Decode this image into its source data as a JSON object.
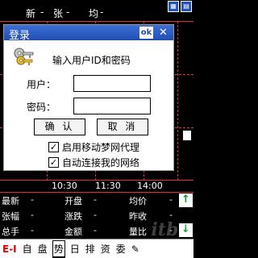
{
  "header": {
    "stats": [
      "新",
      "张",
      "均"
    ],
    "dash": "-",
    "icons": [
      "grid-icon",
      "panel-icon"
    ]
  },
  "time_axis": [
    "10:30",
    "11:30",
    "14:00"
  ],
  "quote": {
    "rows": [
      [
        {
          "label": "最新",
          "value": "-"
        },
        {
          "label": "开盘",
          "value": "-"
        },
        {
          "label": "均价",
          "value": "-"
        }
      ],
      [
        {
          "label": "张幅",
          "value": "-"
        },
        {
          "label": "涨跌",
          "value": "-"
        },
        {
          "label": "昨收",
          "value": "-"
        }
      ],
      [
        {
          "label": "总手",
          "value": "-"
        },
        {
          "label": "金额",
          "value": "-"
        },
        {
          "label": "量比",
          "value": "-"
        }
      ]
    ],
    "scroll_up": "↑",
    "scroll_down": "↓"
  },
  "tabs": [
    "E-I",
    "自",
    "盘",
    "势",
    "日",
    "排",
    "资",
    "委"
  ],
  "active_tab": "势",
  "dialog": {
    "title": "登录",
    "ok_label": "ok",
    "close_label": "✕",
    "prompt": "输入用户ID和密码",
    "user_label": "用户：",
    "password_label": "密码：",
    "user_value": "",
    "password_value": "",
    "confirm_label": "确 认",
    "cancel_label": "取 消",
    "check_proxy_label": "启用移动梦网代理",
    "check_proxy_checked": "✓",
    "check_auto_label": "自动连接我的网络",
    "check_auto_checked": "✓"
  },
  "colors": {
    "grid": "#d33",
    "titlebar": "#214fb0",
    "scroll_arrow": "#0a9b2a",
    "tab_ei": "#d00"
  }
}
